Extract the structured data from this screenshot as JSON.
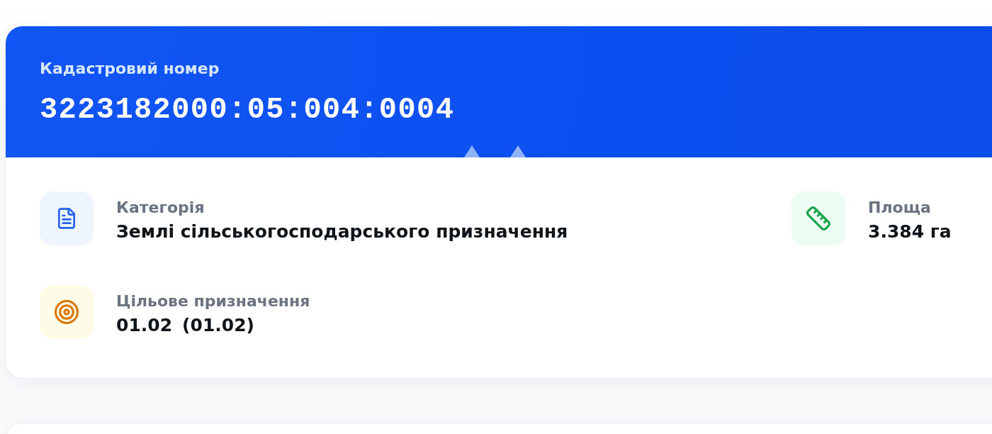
{
  "card": {
    "header": {
      "label": "Кадастровий номер",
      "number": "3223182000:05:004:0004"
    },
    "fields": [
      {
        "kind": "category",
        "label": "Категорія",
        "value": "Землі сільськогосподарського призначення"
      },
      {
        "kind": "area",
        "label": "Площа",
        "value": "3.384 га"
      },
      {
        "kind": "purpose",
        "label": "Цільове призначення",
        "value": "01.02",
        "note": "(01.02)"
      }
    ]
  }
}
